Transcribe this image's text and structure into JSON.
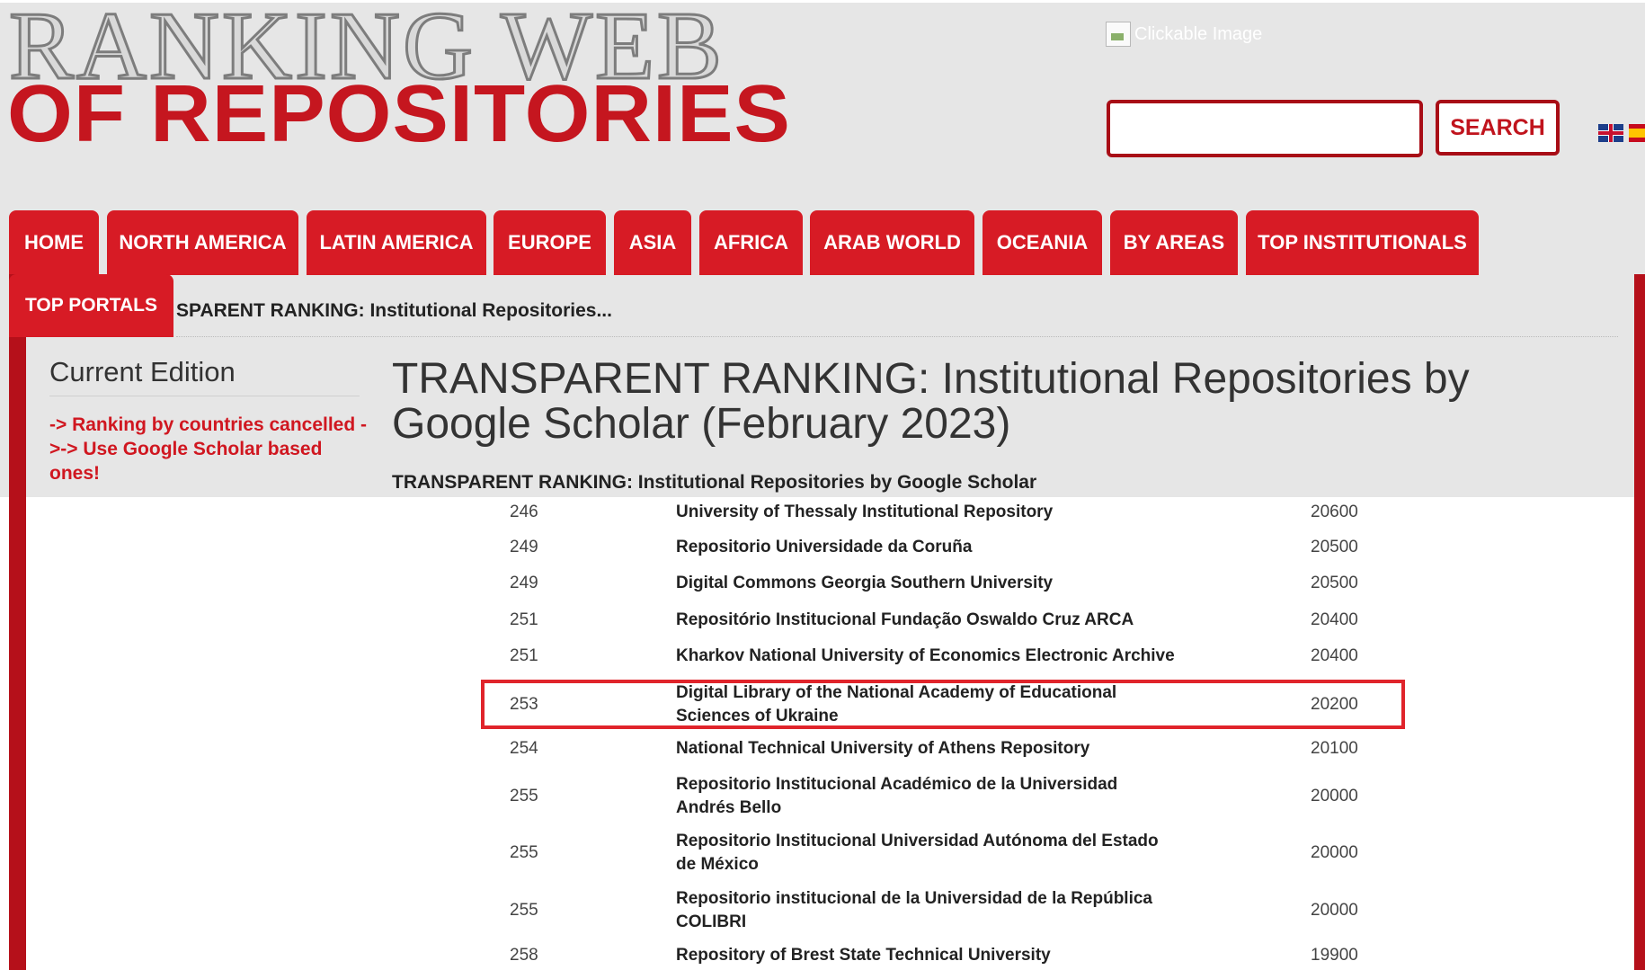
{
  "logo": {
    "line1": "RANKING WEB",
    "line2": "OF REPOSITORIES"
  },
  "header": {
    "image_alt": "Clickable Image",
    "search_placeholder": "",
    "search_button": "SEARCH",
    "languages": [
      "English",
      "Español"
    ]
  },
  "nav": {
    "tabs": [
      "HOME",
      "NORTH AMERICA",
      "LATIN AMERICA",
      "EUROPE",
      "ASIA",
      "AFRICA",
      "ARAB WORLD",
      "OCEANIA",
      "BY AREAS",
      "TOP INSTITUTIONALS"
    ],
    "second_row_tab": "TOP PORTALS"
  },
  "breadcrumb": "SPARENT RANKING: Institutional Repositories...",
  "sidebar": {
    "heading": "Current Edition",
    "note": "-> Ranking by countries cancelled ->-> Use Google Scholar based ones!"
  },
  "main": {
    "title": "TRANSPARENT RANKING: Institutional Repositories by Google Scholar (February 2023)",
    "caption": "TRANSPARENT RANKING: Institutional Repositories by Google Scholar"
  },
  "table": {
    "rows": [
      {
        "rank": "246",
        "name": "University of Thessaly Institutional Repository",
        "value": "20600"
      },
      {
        "rank": "249",
        "name": "Repositorio Universidade da Coruña",
        "value": "20500"
      },
      {
        "rank": "249",
        "name": "Digital Commons Georgia Southern University",
        "value": "20500"
      },
      {
        "rank": "251",
        "name": "Repositório Institucional Fundação Oswaldo Cruz ARCA",
        "value": "20400"
      },
      {
        "rank": "251",
        "name": "Kharkov National University of Economics Electronic Archive",
        "value": "20400"
      },
      {
        "rank": "253",
        "name": "Digital Library of the National Academy of Educational Sciences of Ukraine",
        "value": "20200"
      },
      {
        "rank": "254",
        "name": "National Technical University of Athens Repository",
        "value": "20100"
      },
      {
        "rank": "255",
        "name": "Repositorio Institucional Académico de la Universidad Andrés Bello",
        "value": "20000"
      },
      {
        "rank": "255",
        "name": "Repositorio Institucional Universidad Autónoma del Estado de México",
        "value": "20000"
      },
      {
        "rank": "255",
        "name": "Repositorio institucional de la Universidad de la República COLIBRI",
        "value": "20000"
      },
      {
        "rank": "258",
        "name": "Repository of Brest State Technical University",
        "value": "19900"
      }
    ]
  }
}
